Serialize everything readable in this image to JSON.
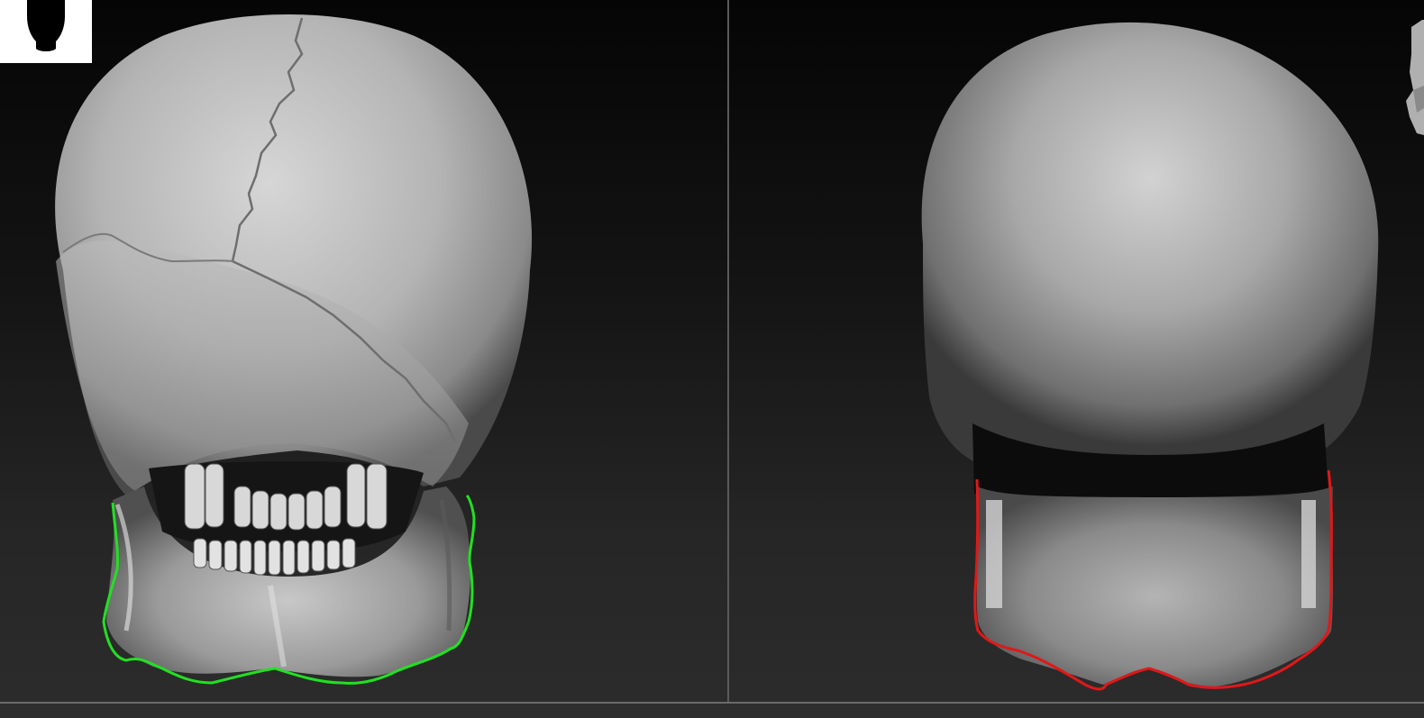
{
  "app": {
    "title": ""
  },
  "viewports": [
    {
      "name": "detailed-skull-view",
      "outline_color": "#22e022",
      "model": "skull-back-view-detailed"
    },
    {
      "name": "simplified-skull-view",
      "outline_color": "#e01818",
      "model": "skull-back-view-simplified"
    }
  ],
  "navigation": {
    "left_icon": "head-silhouette-icon",
    "right_icon": "nav-cube-icon"
  }
}
